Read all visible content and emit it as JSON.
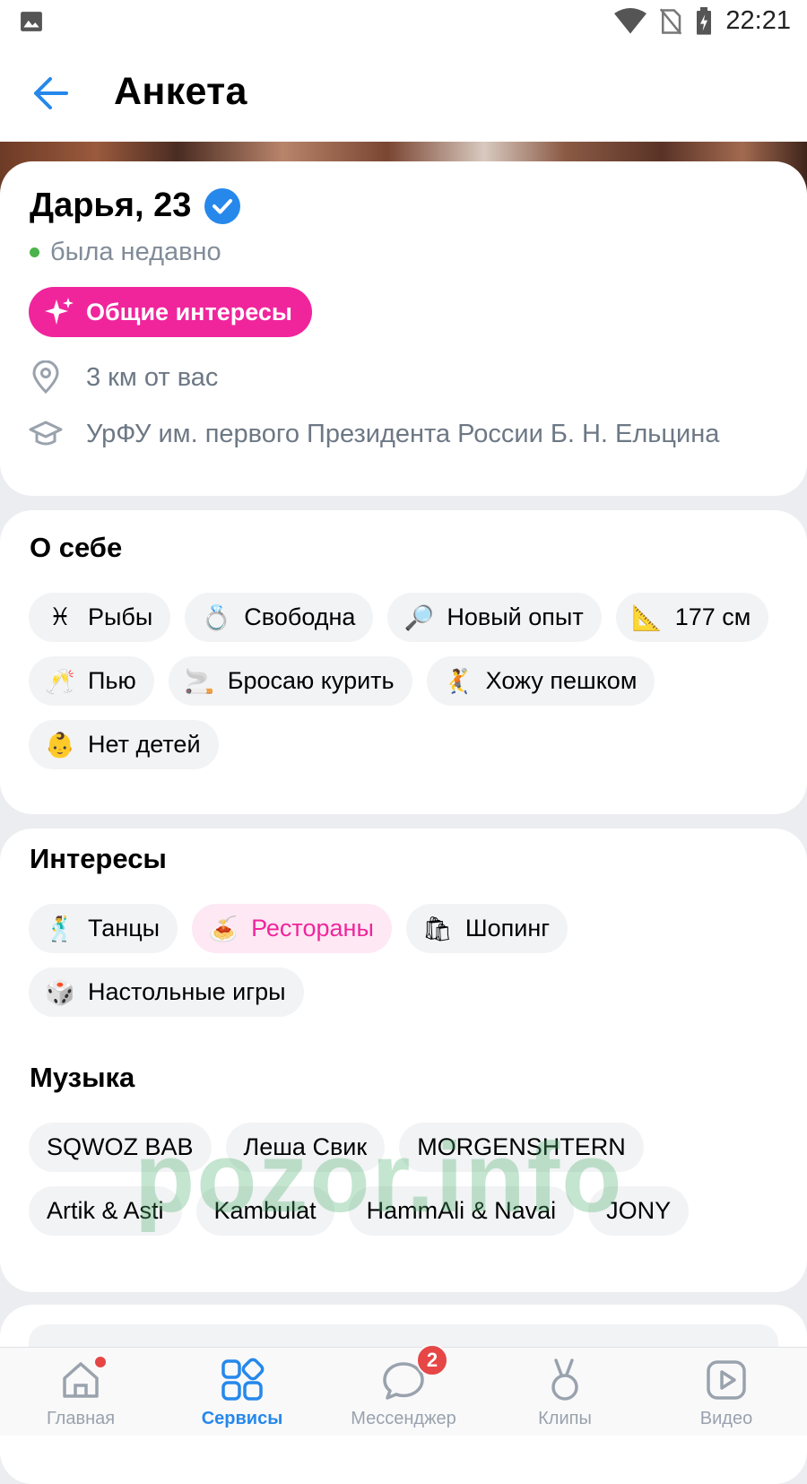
{
  "status_bar": {
    "time": "22:21"
  },
  "header": {
    "title": "Анкета"
  },
  "profile": {
    "name": "Дарья, 23",
    "status": "была недавно",
    "common_button": "Общие интересы",
    "distance": "3 км от вас",
    "education": "УрФУ им. первого Президента России Б. Н. Ельцина"
  },
  "about": {
    "title": "О себе",
    "chips": [
      {
        "emoji": "♓",
        "label": "Рыбы"
      },
      {
        "emoji": "💍",
        "label": "Свободна"
      },
      {
        "emoji": "🔎",
        "label": "Новый опыт"
      },
      {
        "emoji": "📐",
        "label": "177 см"
      },
      {
        "emoji": "🥂",
        "label": "Пью"
      },
      {
        "emoji": "🚬",
        "label": "Бросаю курить"
      },
      {
        "emoji": "🤾",
        "label": "Хожу пешком"
      },
      {
        "emoji": "👶",
        "label": "Нет детей"
      }
    ]
  },
  "interests": {
    "title": "Интересы",
    "chips": [
      {
        "emoji": "🕺",
        "label": "Танцы",
        "highlighted": false
      },
      {
        "emoji": "🍝",
        "label": "Рестораны",
        "highlighted": true
      },
      {
        "emoji": "🛍",
        "label": "Шопинг",
        "highlighted": false
      },
      {
        "emoji": "🎲",
        "label": "Настольные игры",
        "highlighted": false
      }
    ]
  },
  "music": {
    "title": "Музыка",
    "chips": [
      "SQWOZ BAB",
      "Леша Свик",
      "MORGENSHTERN",
      "Artik & Asti",
      "Kambulat",
      "HammAli & Navai",
      "JONY"
    ]
  },
  "watermark": "pozor.info",
  "tabbar": {
    "tabs": [
      {
        "label": "Главная",
        "icon": "home-icon",
        "active": false,
        "dot": true
      },
      {
        "label": "Сервисы",
        "icon": "services-icon",
        "active": true
      },
      {
        "label": "Мессенджер",
        "icon": "messenger-icon",
        "active": false,
        "badge": "2"
      },
      {
        "label": "Клипы",
        "icon": "clips-icon",
        "active": false
      },
      {
        "label": "Видео",
        "icon": "video-icon",
        "active": false
      }
    ]
  },
  "colors": {
    "accent": "#2688eb",
    "pink": "#f0259c",
    "online": "#4bb34b",
    "badge": "#e64646"
  }
}
